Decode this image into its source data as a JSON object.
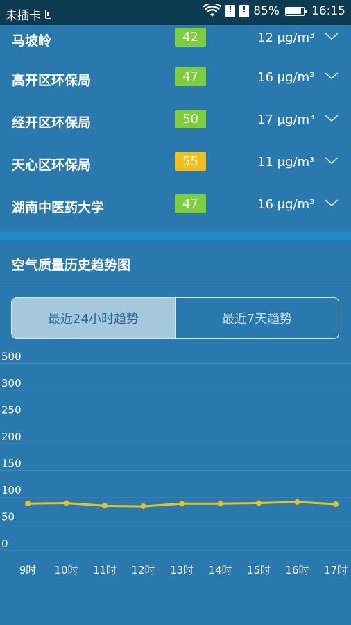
{
  "status_bar": {
    "carrier": "未插卡",
    "battery_percent": "85%",
    "time": "16:15"
  },
  "stations": [
    {
      "name": "马坡岭",
      "aqi": "42",
      "aqi_color": "#7ccf3a",
      "pm": "12 μg/m³"
    },
    {
      "name": "高开区环保局",
      "aqi": "47",
      "aqi_color": "#7ccf3a",
      "pm": "16 μg/m³"
    },
    {
      "name": "经开区环保局",
      "aqi": "50",
      "aqi_color": "#7ccf3a",
      "pm": "17 μg/m³"
    },
    {
      "name": "天心区环保局",
      "aqi": "55",
      "aqi_color": "#f2be1a",
      "pm": "11 μg/m³"
    },
    {
      "name": "湖南中医药大学",
      "aqi": "47",
      "aqi_color": "#7ccf3a",
      "pm": "16 μg/m³"
    }
  ],
  "trend_section": {
    "title": "空气质量历史趋势图",
    "tabs": [
      "最近24小时趋势",
      "最近7天趋势"
    ],
    "active_tab": 0
  },
  "chart_data": {
    "type": "line",
    "categories": [
      "9时",
      "10时",
      "11时",
      "12时",
      "13时",
      "14时",
      "15时",
      "16时",
      "17时"
    ],
    "series": [
      {
        "values": [
          88,
          89,
          84,
          83,
          88,
          88,
          89,
          91,
          87
        ],
        "color": "#e9c21f"
      }
    ],
    "y_ticks": [
      "0",
      "50",
      "100",
      "150",
      "200",
      "250",
      "300",
      "500"
    ],
    "grid": true
  }
}
